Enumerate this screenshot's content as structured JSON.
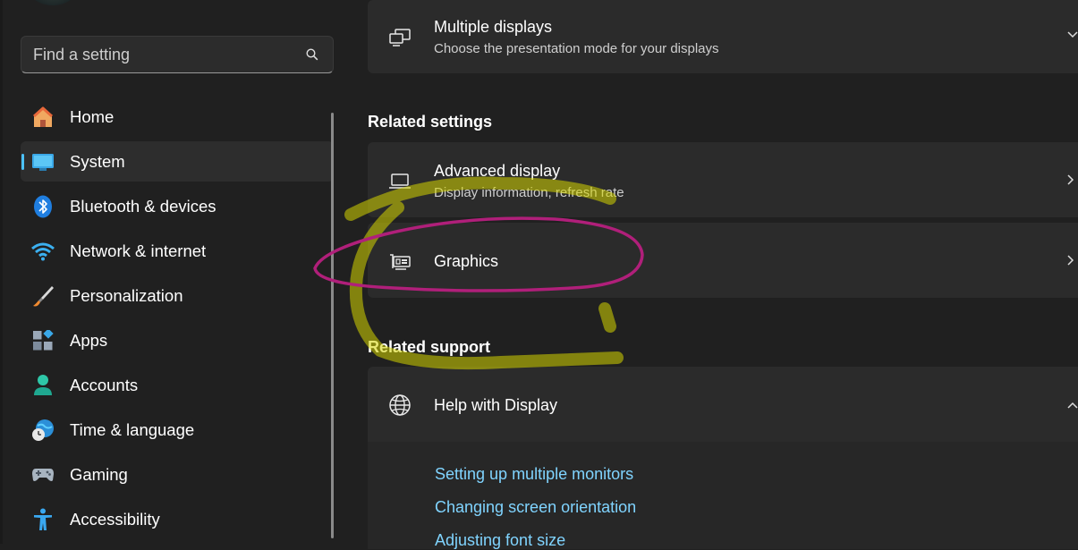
{
  "search": {
    "placeholder": "Find a setting"
  },
  "sidebar": {
    "items": [
      {
        "label": "Home",
        "icon": "home-icon"
      },
      {
        "label": "System",
        "icon": "system-icon",
        "selected": true
      },
      {
        "label": "Bluetooth & devices",
        "icon": "bluetooth-icon"
      },
      {
        "label": "Network & internet",
        "icon": "wifi-icon"
      },
      {
        "label": "Personalization",
        "icon": "brush-icon"
      },
      {
        "label": "Apps",
        "icon": "apps-icon"
      },
      {
        "label": "Accounts",
        "icon": "accounts-icon"
      },
      {
        "label": "Time & language",
        "icon": "globe-clock-icon"
      },
      {
        "label": "Gaming",
        "icon": "gamepad-icon"
      },
      {
        "label": "Accessibility",
        "icon": "accessibility-icon"
      }
    ]
  },
  "main": {
    "multiple_displays": {
      "title": "Multiple displays",
      "subtitle": "Choose the presentation mode for your displays"
    },
    "related_settings": {
      "heading": "Related settings",
      "advanced_display": {
        "title": "Advanced display",
        "subtitle": "Display information, refresh rate"
      },
      "graphics": {
        "title": "Graphics"
      }
    },
    "related_support": {
      "heading": "Related support",
      "help": {
        "title": "Help with Display"
      },
      "links": [
        "Setting up multiple monitors",
        "Changing screen orientation",
        "Adjusting font size"
      ]
    }
  },
  "colors": {
    "accent": "#4cc2ff",
    "link": "#80d4ff",
    "annotation_magenta": "#b01f7a",
    "annotation_yellow": "#d6d600"
  }
}
